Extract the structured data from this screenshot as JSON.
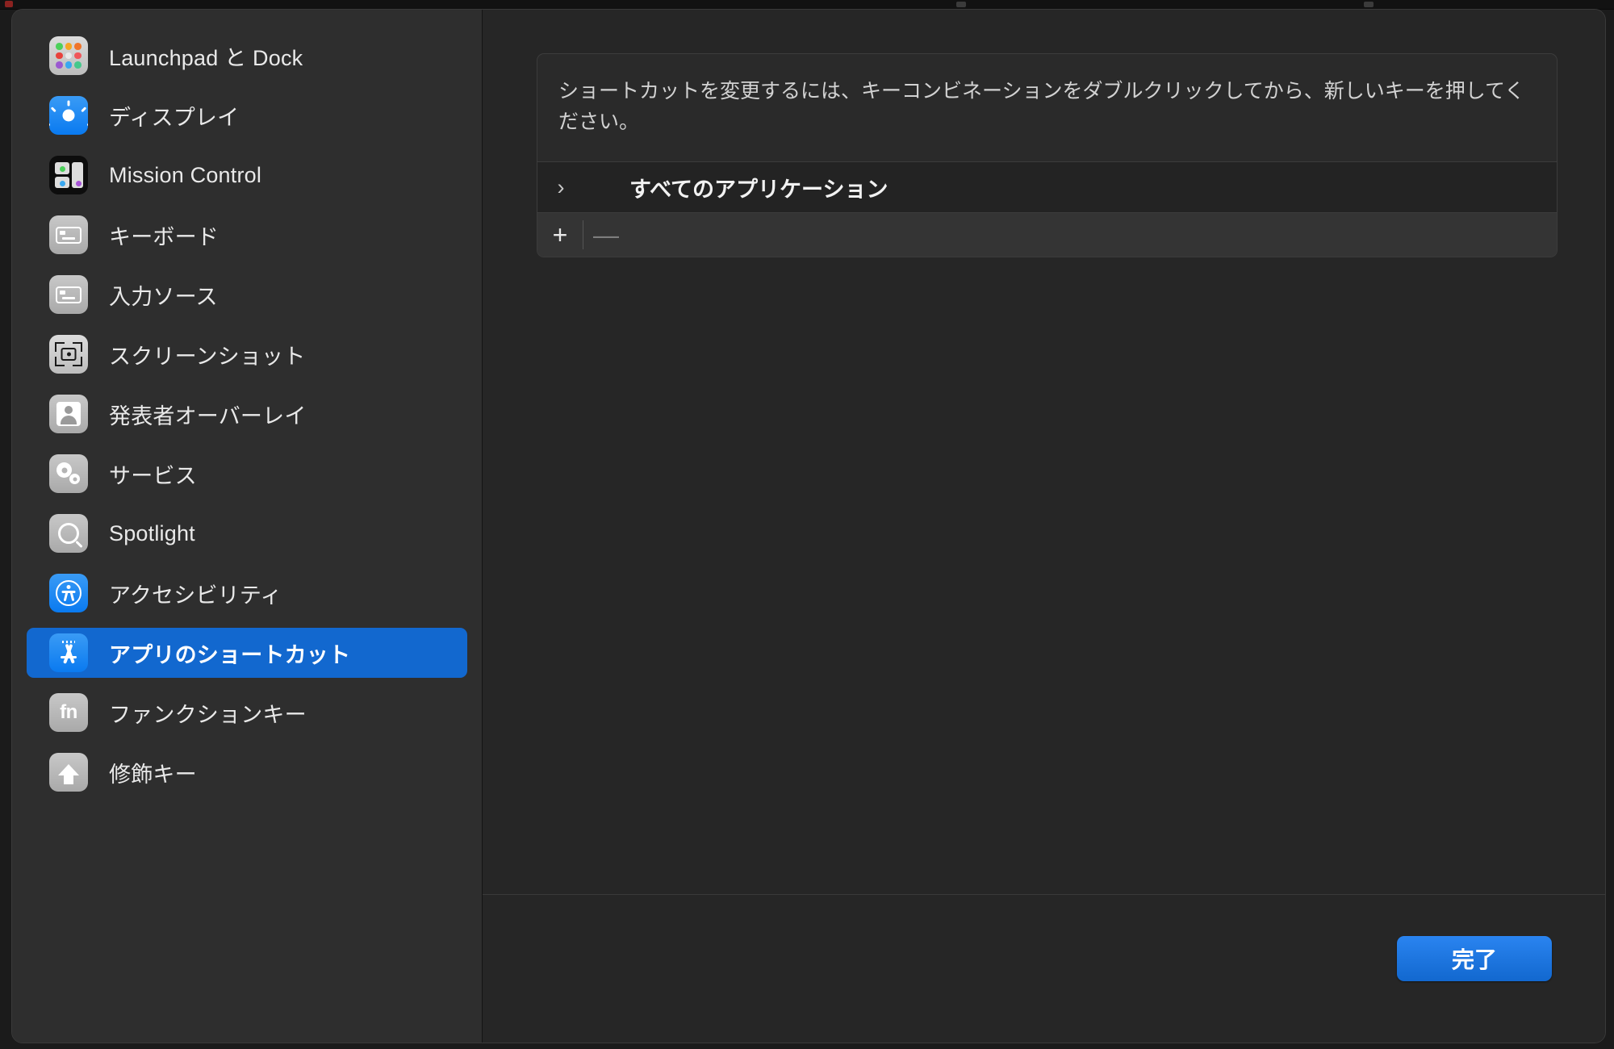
{
  "window": {
    "sidebar": {
      "items": [
        {
          "label": "Launchpad と Dock",
          "icon": "launchpad-icon",
          "selected": false
        },
        {
          "label": "ディスプレイ",
          "icon": "display-brightness-icon",
          "selected": false
        },
        {
          "label": "Mission Control",
          "icon": "mission-control-icon",
          "selected": false
        },
        {
          "label": "キーボード",
          "icon": "keyboard-icon",
          "selected": false
        },
        {
          "label": "入力ソース",
          "icon": "input-sources-icon",
          "selected": false
        },
        {
          "label": "スクリーンショット",
          "icon": "screenshot-icon",
          "selected": false
        },
        {
          "label": "発表者オーバーレイ",
          "icon": "presenter-overlay-icon",
          "selected": false
        },
        {
          "label": "サービス",
          "icon": "services-gears-icon",
          "selected": false
        },
        {
          "label": "Spotlight",
          "icon": "spotlight-search-icon",
          "selected": false
        },
        {
          "label": "アクセシビリティ",
          "icon": "accessibility-icon",
          "selected": false
        },
        {
          "label": "アプリのショートカット",
          "icon": "app-shortcuts-icon",
          "selected": true
        },
        {
          "label": "ファンクションキー",
          "icon": "fn-key-icon",
          "selected": false
        },
        {
          "label": "修飾キー",
          "icon": "modifier-key-icon",
          "selected": false
        }
      ]
    },
    "main": {
      "note": "ショートカットを変更するには、キーコンビネーションをダブルクリックしてから、新しいキーを押してください。",
      "group_row": {
        "disclosure_glyph": "›",
        "label": "すべてのアプリケーション"
      },
      "toolbar": {
        "add_label": "+",
        "remove_label": "—"
      },
      "done_label": "完了"
    },
    "colors": {
      "accent": "#1268cf",
      "sidebar_bg": "#2e2e2e",
      "content_bg": "#262626",
      "panel_bg": "#2a2a2a",
      "row_bg": "#232323",
      "text": "#e9e9e9"
    }
  }
}
